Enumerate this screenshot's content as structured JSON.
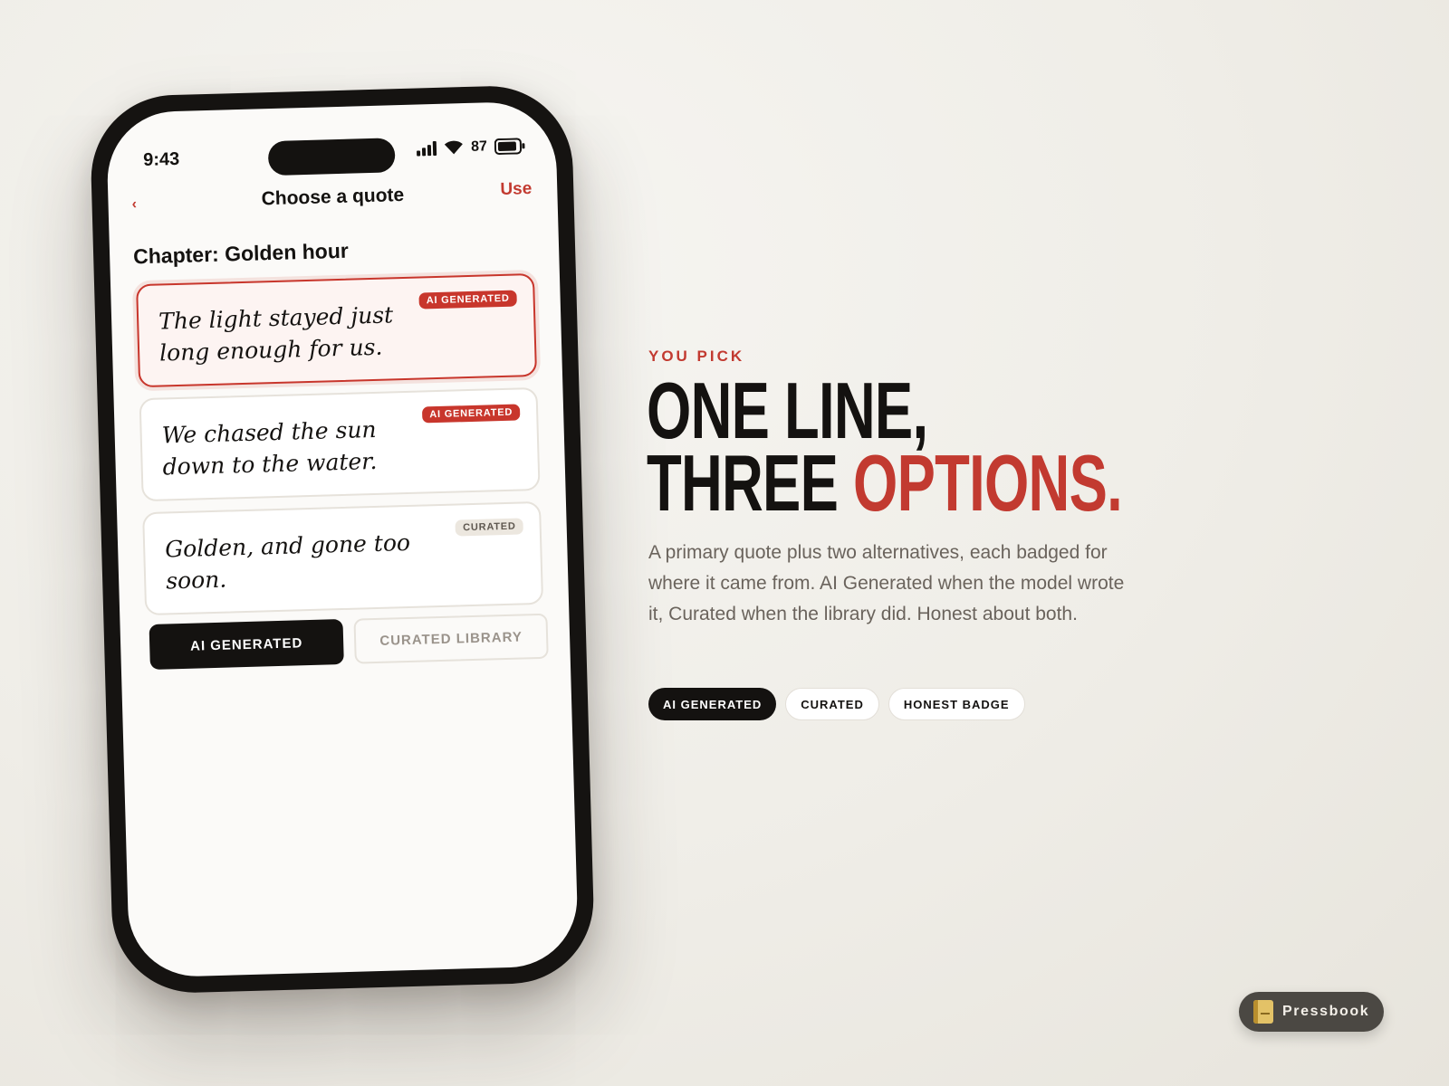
{
  "phone": {
    "status": {
      "time": "9:43",
      "battery": "87"
    },
    "nav": {
      "back_icon": "chevron-left-icon",
      "title": "Choose a quote",
      "action": "Use"
    },
    "chapter_title": "Chapter: Golden hour",
    "quotes": [
      {
        "text": "The light stayed just long enough for us.",
        "badge": "AI GENERATED",
        "selected": true
      },
      {
        "text": "We chased the sun down to the water.",
        "badge": "AI GENERATED",
        "selected": false
      },
      {
        "text": "Golden, and gone too soon.",
        "badge": "CURATED",
        "selected": false
      }
    ],
    "segments": {
      "active": "AI GENERATED",
      "inactive": "CURATED LIBRARY"
    }
  },
  "copy": {
    "eyebrow": "YOU PICK",
    "headline_line1": "ONE LINE,",
    "headline_line2_a": "THREE ",
    "headline_line2_b": "OPTIONS.",
    "description": "A primary quote plus two alternatives, each badged for where it came from. AI Generated when the model wrote it, Curated when the library did. Honest about both.",
    "chips": [
      "AI GENERATED",
      "CURATED",
      "HONEST BADGE"
    ]
  },
  "brand": {
    "name": "Pressbook",
    "icon": "book-icon"
  },
  "colors": {
    "accent": "#c23a30",
    "ink": "#141210",
    "background": "#efede7",
    "muted_text": "#6a635c"
  }
}
